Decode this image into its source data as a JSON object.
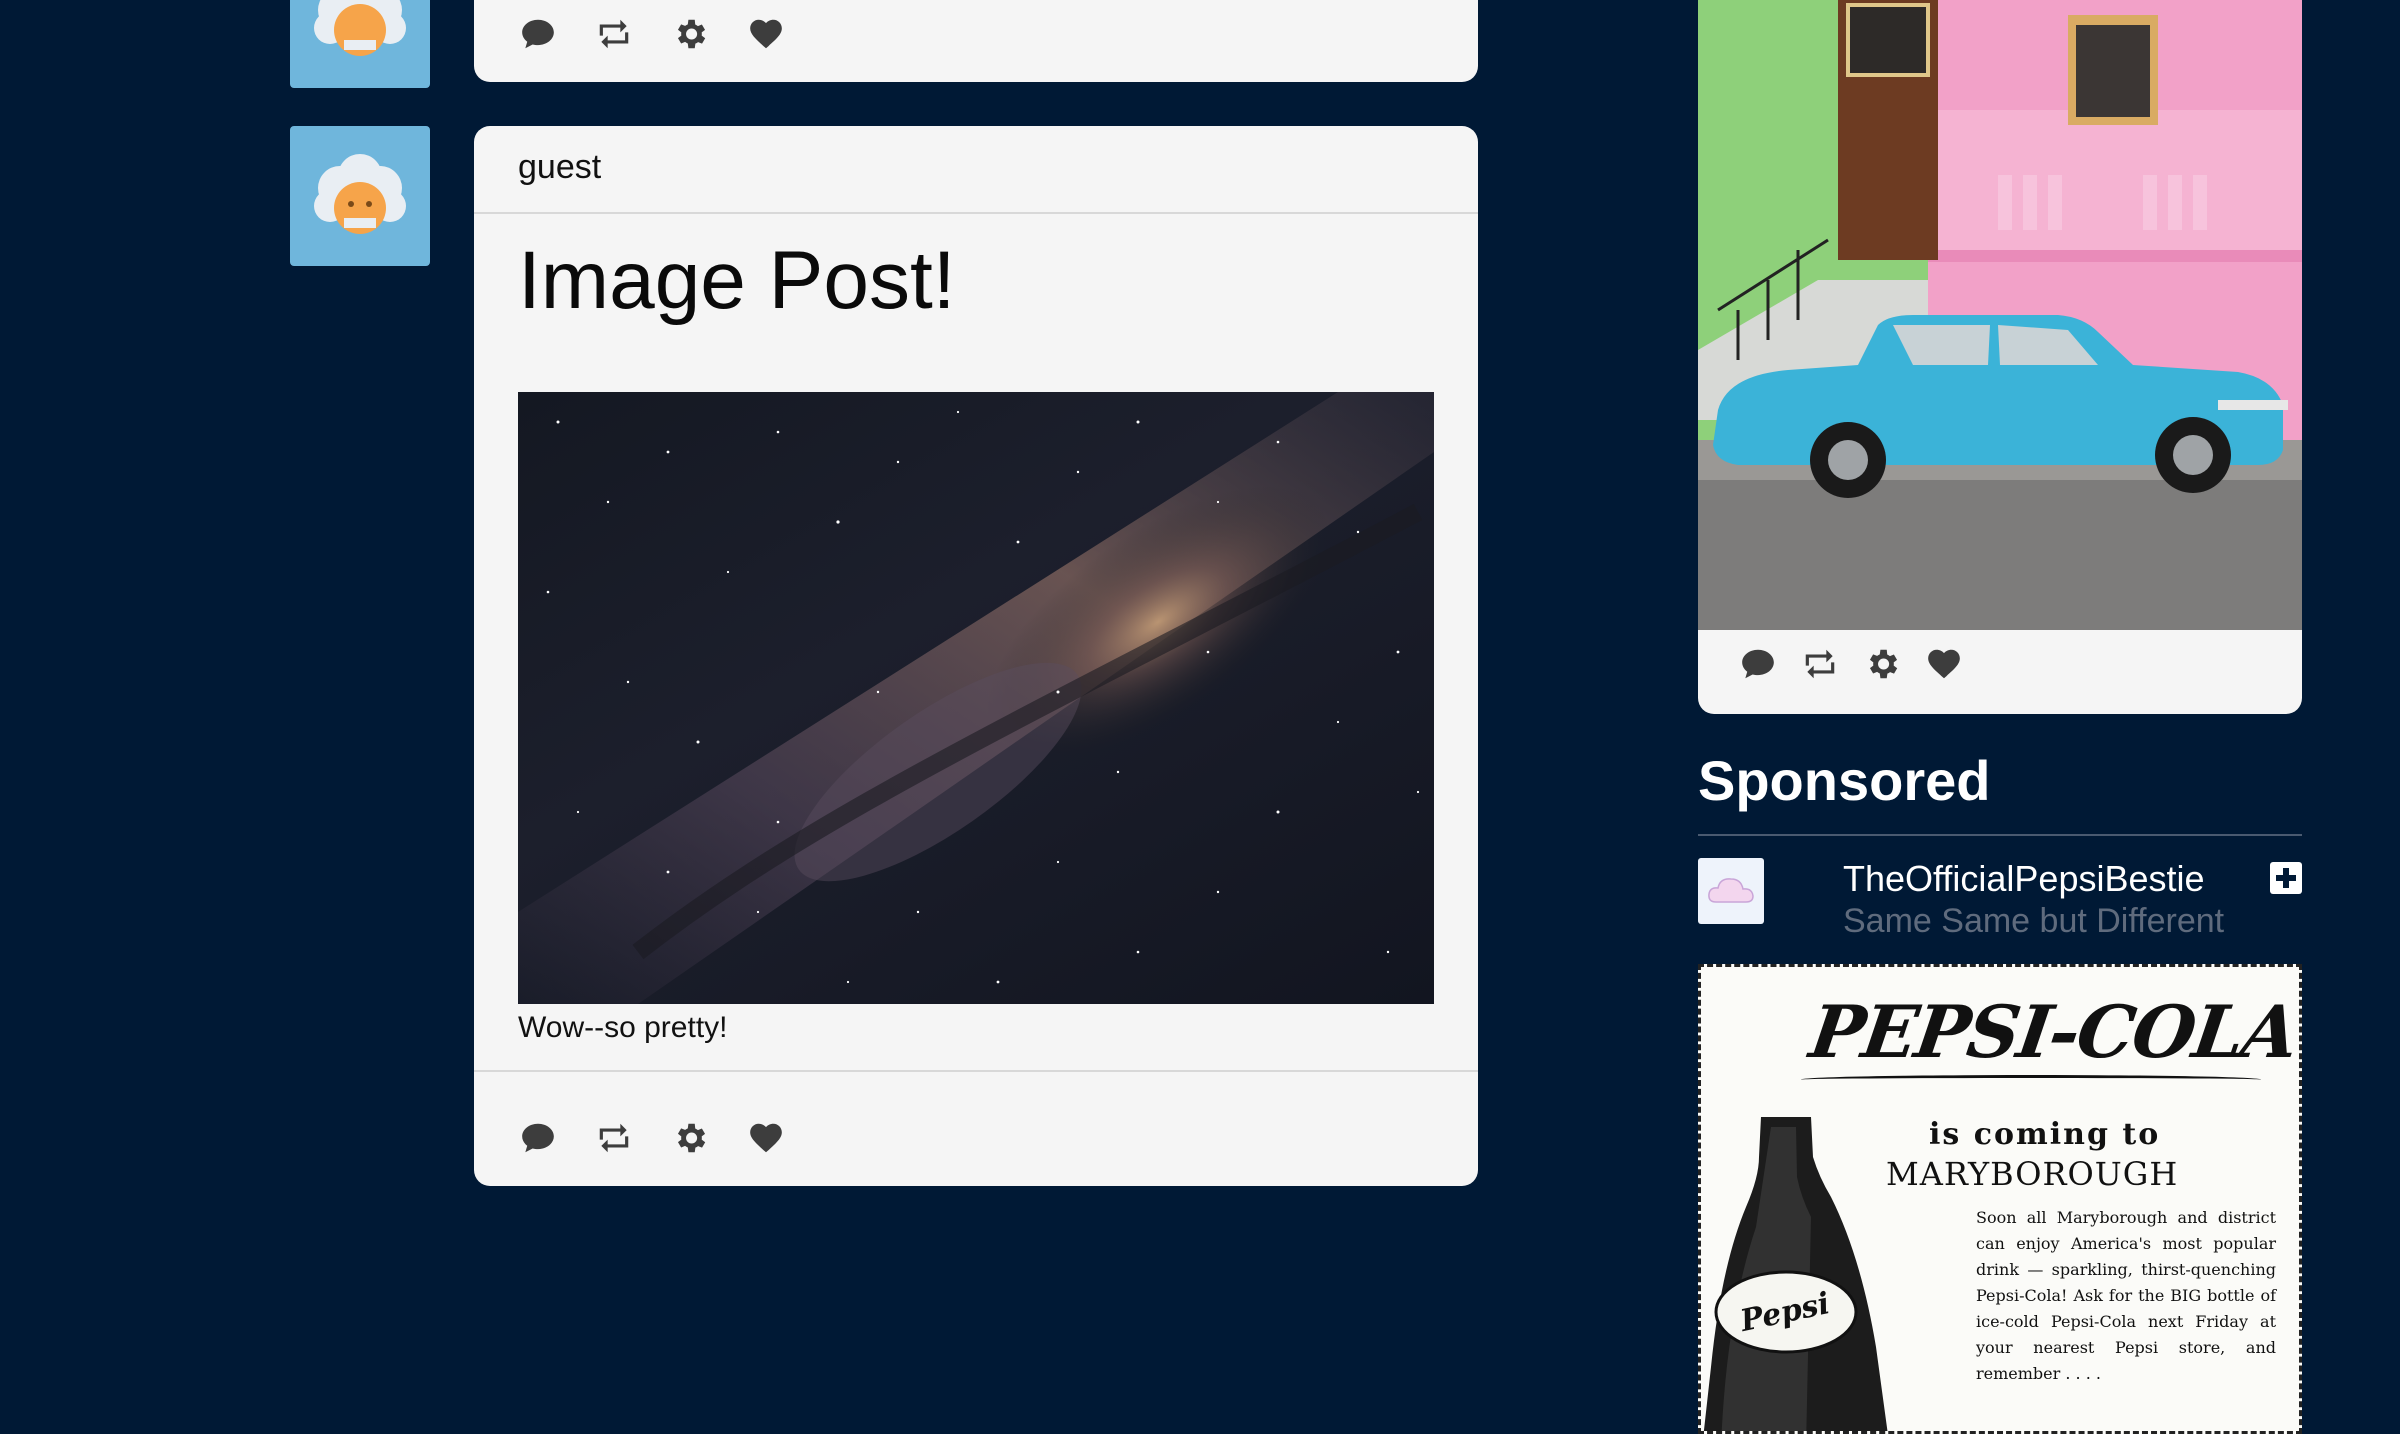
{
  "feed": {
    "post_prev": {
      "actions": [
        "speech-bubble-icon",
        "reblog-icon",
        "gear-icon",
        "heart-icon"
      ]
    },
    "post_image": {
      "username": "guest",
      "title": "Image Post!",
      "caption": "Wow--so pretty!",
      "actions": [
        "speech-bubble-icon",
        "reblog-icon",
        "gear-icon",
        "heart-icon"
      ]
    }
  },
  "sidebar": {
    "radar_post": {
      "actions": [
        "speech-bubble-icon",
        "reblog-icon",
        "gear-icon",
        "heart-icon"
      ]
    },
    "sponsored": {
      "heading": "Sponsored",
      "blog_name": "TheOfficialPepsiBestie",
      "blog_tagline": "Same Same but Different",
      "ad": {
        "logo": "PEPSI-COLA",
        "line1": "is coming to",
        "line2": "MARYBOROUGH",
        "body": "Soon all Maryborough and district can enjoy America's most popular drink — sparkling, thirst-quenching Pepsi-Cola! Ask for the BIG bottle of ice-cold Pepsi-Cola next Friday at your nearest Pepsi store, and remember . . . ."
      }
    }
  },
  "colors": {
    "background": "#001935",
    "card": "#f5f5f5",
    "avatar": "#6fb6dc",
    "icon": "#3d3d3d"
  }
}
